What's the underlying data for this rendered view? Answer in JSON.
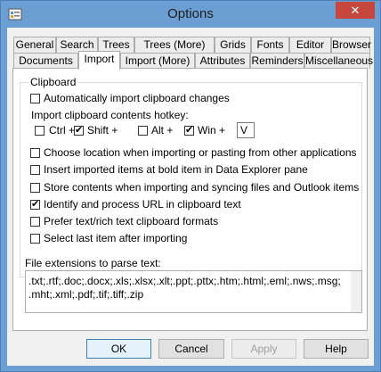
{
  "window": {
    "title": "Options",
    "close_glyph": "✕",
    "app_icon": "options-app-icon"
  },
  "tabs": {
    "row1": [
      "General",
      "Search",
      "Trees",
      "Trees (More)",
      "Grids",
      "Fonts",
      "Editor",
      "Browser"
    ],
    "row2": [
      "Documents",
      "Import",
      "Import (More)",
      "Attributes",
      "Reminders",
      "Miscellaneous"
    ],
    "active": "Import"
  },
  "clipboard": {
    "group_title": "Clipboard",
    "auto_import": {
      "label": "Automatically import clipboard changes",
      "checked": false
    },
    "hotkey_label": "Import clipboard contents hotkey:",
    "hotkey": {
      "ctrl": {
        "label": "Ctrl +",
        "checked": false
      },
      "shift": {
        "label": "Shift +",
        "checked": true
      },
      "alt": {
        "label": "Alt +",
        "checked": false
      },
      "win": {
        "label": "Win +",
        "checked": true
      },
      "key": "V"
    },
    "options": [
      {
        "label": "Choose location when importing or pasting from other applications",
        "checked": false
      },
      {
        "label": "Insert imported items at bold item in Data Explorer pane",
        "checked": false
      },
      {
        "label": "Store contents when importing and syncing files and Outlook items",
        "checked": false
      },
      {
        "label": "Identify and process URL in clipboard text",
        "checked": true
      },
      {
        "label": "Prefer text/rich text clipboard formats",
        "checked": false
      },
      {
        "label": "Select last item after importing",
        "checked": false
      }
    ]
  },
  "extensions": {
    "label": "File extensions to parse text:",
    "line1": ".txt;.rtf;.doc;.docx;.xls;.xlsx;.xlt;.ppt;.pttx;.htm;.html;.eml;.nws;.msg;",
    "line2": ".mht;.xml;.pdf;.tif;.tiff;.zip"
  },
  "buttons": {
    "ok": "OK",
    "cancel": "Cancel",
    "apply": "Apply",
    "help": "Help"
  },
  "colors": {
    "title_bar": "#6b9fd4",
    "close": "#c7463d",
    "default_button_border": "#3c7fb1"
  }
}
